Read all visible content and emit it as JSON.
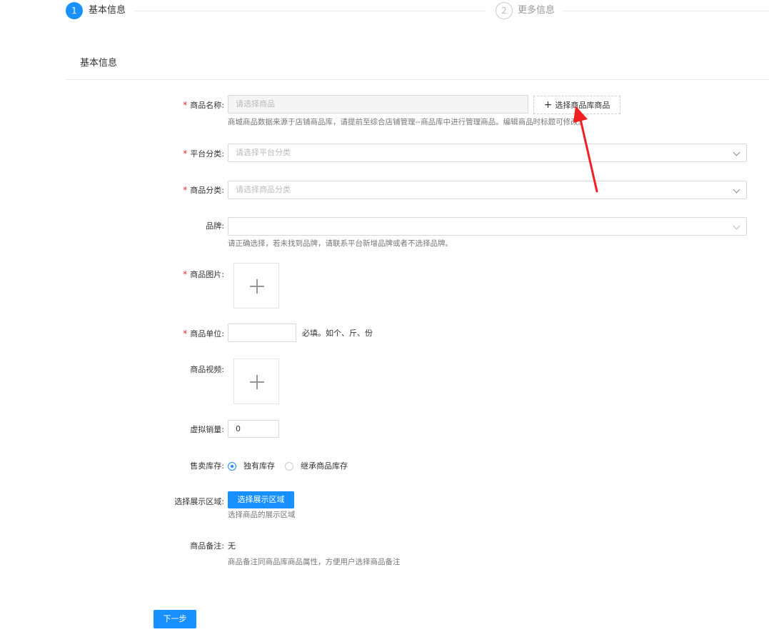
{
  "steps": [
    {
      "number": "1",
      "title": "基本信息",
      "state": "active"
    },
    {
      "number": "2",
      "title": "更多信息",
      "state": "wait"
    }
  ],
  "section": {
    "title": "基本信息"
  },
  "form": {
    "product_name": {
      "label": "商品名称:",
      "placeholder": "请选择商品",
      "library_button": "选择商品库商品",
      "hint": "商城商品数据来源于店铺商品库，请提前至综合店铺管理--商品库中进行管理商品。编辑商品时标题可修改。"
    },
    "platform_category": {
      "label": "平台分类:",
      "placeholder": "请选择平台分类"
    },
    "product_category": {
      "label": "商品分类:",
      "placeholder": "请选择商品分类"
    },
    "brand": {
      "label": "品牌:",
      "value": "",
      "hint": "请正确选择，若未找到品牌，请联系平台新增品牌或者不选择品牌。"
    },
    "product_image": {
      "label": "商品图片:"
    },
    "product_unit": {
      "label": "商品单位:",
      "value": "",
      "hint": "必填。如个、斤、份"
    },
    "product_video": {
      "label": "商品视频:"
    },
    "virtual_sales": {
      "label": "虚拟销量:",
      "value": "0"
    },
    "stock": {
      "label": "售卖库存:",
      "options": [
        {
          "label": "独有库存",
          "checked": true
        },
        {
          "label": "继承商品库存",
          "checked": false
        }
      ]
    },
    "display_area": {
      "label": "选择展示区域:",
      "button": "选择展示区域",
      "hint": "选择商品的展示区域"
    },
    "remark": {
      "label": "商品备注:",
      "value": "无",
      "hint": "商品备注同商品库商品属性，方便用户选择商品备注"
    }
  },
  "footer": {
    "next_button": "下一步"
  },
  "colors": {
    "primary": "#1890ff",
    "required": "#f5222d",
    "annotation_arrow": "#f02020"
  }
}
